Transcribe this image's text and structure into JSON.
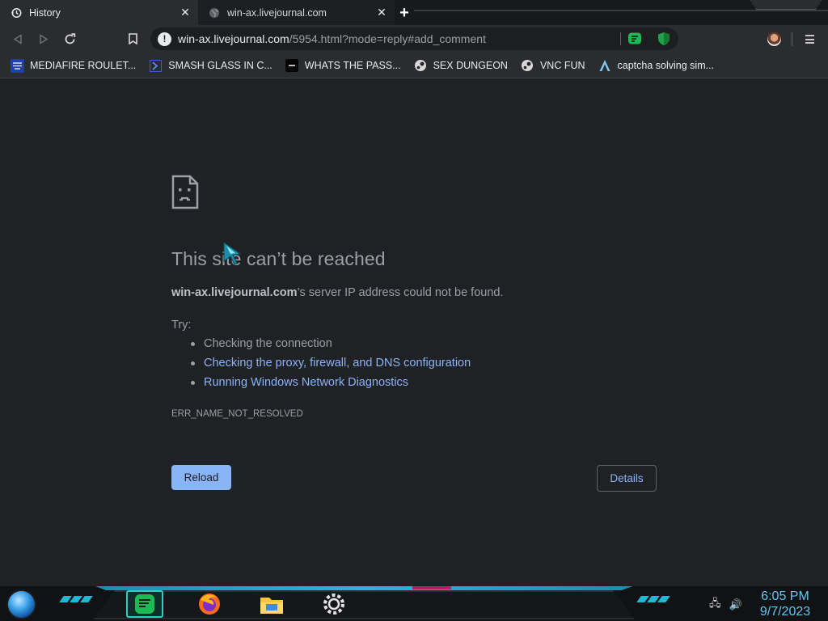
{
  "tabs": [
    {
      "label": "History",
      "icon": "history-icon",
      "close": "✕"
    },
    {
      "label": "win-ax.livejournal.com",
      "icon": "globe-icon",
      "close": "✕"
    }
  ],
  "newtab_label": "+",
  "toolbar": {
    "url_host": "win-ax.livejournal.com",
    "url_path": "/5954.html?mode=reply#add_comment",
    "warning_glyph": "!"
  },
  "bookmarks": [
    {
      "label": "MEDIAFIRE ROULET...",
      "icon": "mediafire-icon"
    },
    {
      "label": "SMASH GLASS IN C...",
      "icon": "chevron-right-icon"
    },
    {
      "label": "WHATS THE PASS...",
      "icon": "terminal-icon"
    },
    {
      "label": "SEX DUNGEON",
      "icon": "steam-icon"
    },
    {
      "label": "VNC FUN",
      "icon": "steam-icon"
    },
    {
      "label": "captcha solving sim...",
      "icon": "arch-icon"
    }
  ],
  "error": {
    "title": "This site can’t be reached",
    "host": "win-ax.livejournal.com",
    "desc_rest": "’s server IP address could not be found.",
    "try_label": "Try:",
    "suggestions": [
      "Checking the connection",
      "Checking the proxy, firewall, and DNS configuration",
      "Running Windows Network Diagnostics"
    ],
    "code": "ERR_NAME_NOT_RESOLVED",
    "reload_label": "Reload",
    "details_label": "Details"
  },
  "taskbar": {
    "time": "6:05 PM",
    "date": "9/7/2023",
    "apps": [
      "notes-icon",
      "firefox-icon",
      "file-explorer-icon",
      "gear-app-icon"
    ]
  },
  "colors": {
    "link": "#8ab4f8",
    "accent": "#27b7d8",
    "clock": "#5fc7f2"
  }
}
